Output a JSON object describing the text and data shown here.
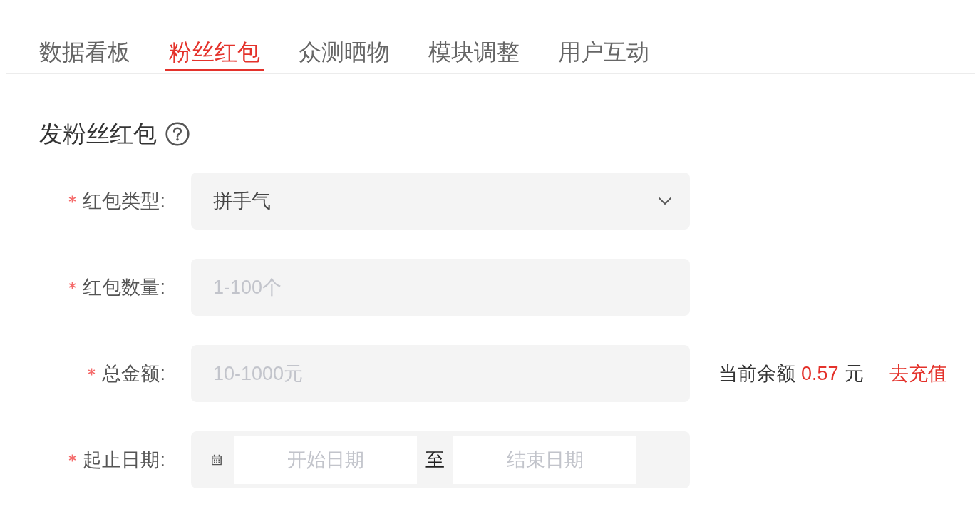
{
  "tabs": [
    {
      "label": "数据看板",
      "selected": false
    },
    {
      "label": "粉丝红包",
      "selected": true
    },
    {
      "label": "众测晒物",
      "selected": false
    },
    {
      "label": "模块调整",
      "selected": false
    },
    {
      "label": "用户互动",
      "selected": false
    }
  ],
  "section": {
    "title": "发粉丝红包"
  },
  "form": {
    "fields": [
      {
        "kind": "select",
        "label": "红包类型:",
        "required": true,
        "value": "拼手气"
      },
      {
        "kind": "input",
        "label": "红包数量:",
        "required": true,
        "placeholder": "1-100个"
      },
      {
        "kind": "input",
        "label": "总金额:",
        "required": true,
        "placeholder": "10-1000元",
        "balance": {
          "label": "当前余额",
          "amount": "0.57",
          "unit": "元"
        },
        "action": "去充值"
      },
      {
        "kind": "daterange",
        "label": "起止日期:",
        "required": true,
        "start_placeholder": "开始日期",
        "separator": "至",
        "end_placeholder": "结束日期"
      }
    ]
  }
}
